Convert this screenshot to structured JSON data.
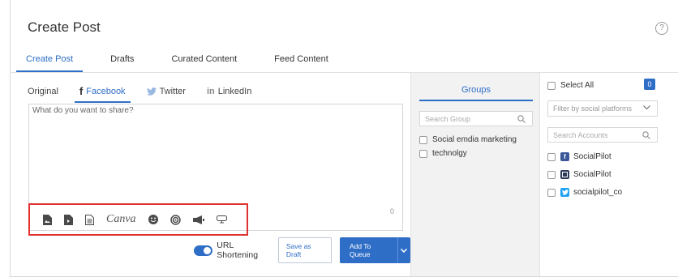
{
  "header": {
    "title": "Create Post",
    "help_icon": "?"
  },
  "main_tabs": [
    {
      "label": "Create Post",
      "active": true
    },
    {
      "label": "Drafts"
    },
    {
      "label": "Curated Content"
    },
    {
      "label": "Feed Content"
    }
  ],
  "network_tabs": [
    {
      "label": "Original"
    },
    {
      "label": "Facebook",
      "icon": "f",
      "active": true
    },
    {
      "label": "Twitter",
      "icon": "twitter-icon"
    },
    {
      "label": "LinkedIn",
      "icon": "in"
    }
  ],
  "editor": {
    "placeholder": "What do you want to share?",
    "char_count": "0"
  },
  "toolbar": {
    "icons": [
      "image-upload-icon",
      "video-upload-icon",
      "document-icon",
      "canva-icon",
      "emoji-icon",
      "target-icon",
      "megaphone-icon",
      "link-icon"
    ],
    "canva_label": "Canva"
  },
  "actions": {
    "url_shortening_label": "URL Shortening",
    "url_shortening_on": true,
    "save_draft_label": "Save as Draft",
    "add_queue_label": "Add To Queue"
  },
  "groups": {
    "tab_label": "Groups",
    "search_placeholder": "Search Group",
    "items": [
      "Social emdia marketing",
      "technolgy"
    ]
  },
  "accounts": {
    "select_all_label": "Select All",
    "selected_count": "0",
    "filter_placeholder": "Filter by social platforms",
    "search_placeholder": "Search Accounts",
    "items": [
      {
        "name": "SocialPilot",
        "platform": "facebook",
        "color": "#3b5998"
      },
      {
        "name": "SocialPilot",
        "platform": "page",
        "color": "#2d3a5a"
      },
      {
        "name": "socialpilot_co",
        "platform": "twitter",
        "color": "#1da1f2"
      }
    ]
  },
  "colors": {
    "accent": "#2f6ec7",
    "highlight_box": "#e03030"
  }
}
